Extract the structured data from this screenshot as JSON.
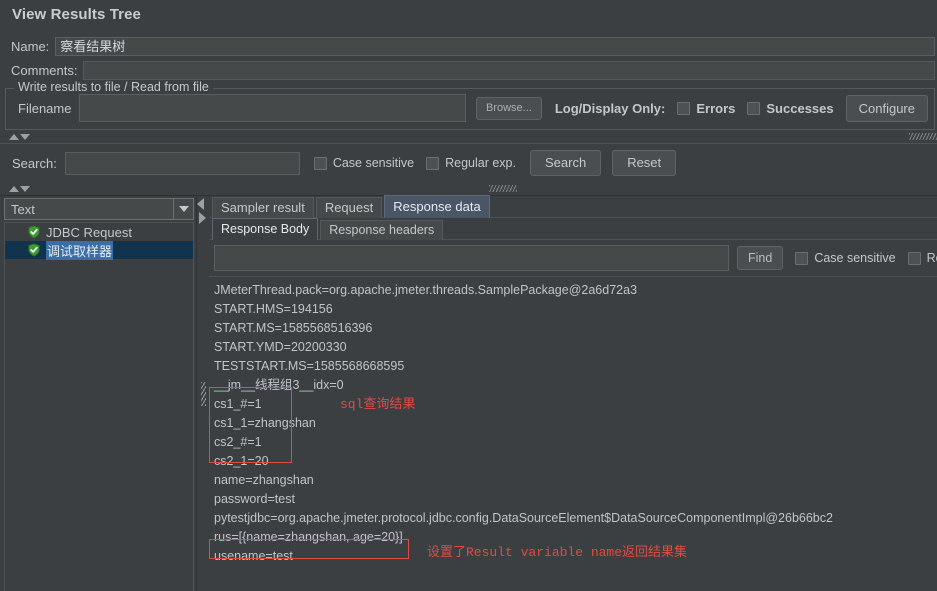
{
  "window": {
    "title": "View Results Tree"
  },
  "form": {
    "name_label": "Name:",
    "name_value": "察看结果树",
    "comments_label": "Comments:",
    "comments_value": ""
  },
  "file_group": {
    "legend": "Write results to file / Read from file",
    "filename_label": "Filename",
    "filename_value": "",
    "browse_label": "Browse...",
    "log_display_label": "Log/Display Only:",
    "errors_label": "Errors",
    "errors_checked": false,
    "successes_label": "Successes",
    "successes_checked": false,
    "configure_label": "Configure"
  },
  "search_panel": {
    "search_label": "Search:",
    "search_value": "",
    "case_sensitive_label": "Case sensitive",
    "case_sensitive_checked": false,
    "regular_exp_label": "Regular exp.",
    "regular_exp_checked": false,
    "search_button": "Search",
    "reset_button": "Reset"
  },
  "left_panel": {
    "render_combo_value": "Text",
    "tree_items": [
      {
        "label": "JDBC Request",
        "icon": "success-shield-icon",
        "selected": false
      },
      {
        "label": "调试取样器",
        "icon": "success-shield-icon",
        "selected": true
      }
    ]
  },
  "right_panel": {
    "tabs": [
      {
        "label": "Sampler result",
        "active": false
      },
      {
        "label": "Request",
        "active": false
      },
      {
        "label": "Response data",
        "active": true
      }
    ],
    "subtabs": [
      {
        "label": "Response Body",
        "active": true
      },
      {
        "label": "Response headers",
        "active": false
      }
    ],
    "find_row": {
      "find_value": "",
      "find_button": "Find",
      "case_sensitive_label": "Case sensitive",
      "case_sensitive_checked": false,
      "regular_exp_label": "Regular",
      "regular_exp_checked": false
    },
    "response_body_lines": [
      "JMeterThread.pack=org.apache.jmeter.threads.SamplePackage@2a6d72a3",
      "START.HMS=194156",
      "START.MS=1585568516396",
      "START.YMD=20200330",
      "TESTSTART.MS=1585568668595",
      "__jm__线程组3__idx=0",
      "cs1_#=1",
      "cs1_1=zhangshan",
      "cs2_#=1",
      "cs2_1=20",
      "name=zhangshan",
      "password=test",
      "pytestjdbc=org.apache.jmeter.protocol.jdbc.config.DataSourceElement$DataSourceComponentImpl@26b66bc2",
      "rus=[{name=zhangshan, age=20}]",
      "usename=test"
    ],
    "annotations": [
      {
        "text": "sql查询结果",
        "name": "sql-result-annotation"
      },
      {
        "text": "设置了Result variable name返回结果集",
        "name": "result-variable-annotation"
      }
    ]
  },
  "colors": {
    "background": "#3c3f41",
    "field": "#45494a",
    "text": "#c3c8cd",
    "accent_tab": "#4a5565",
    "selection": "#3a6ea5",
    "annotation_red": "#e04b45",
    "shield_green": "#3f9c35"
  }
}
